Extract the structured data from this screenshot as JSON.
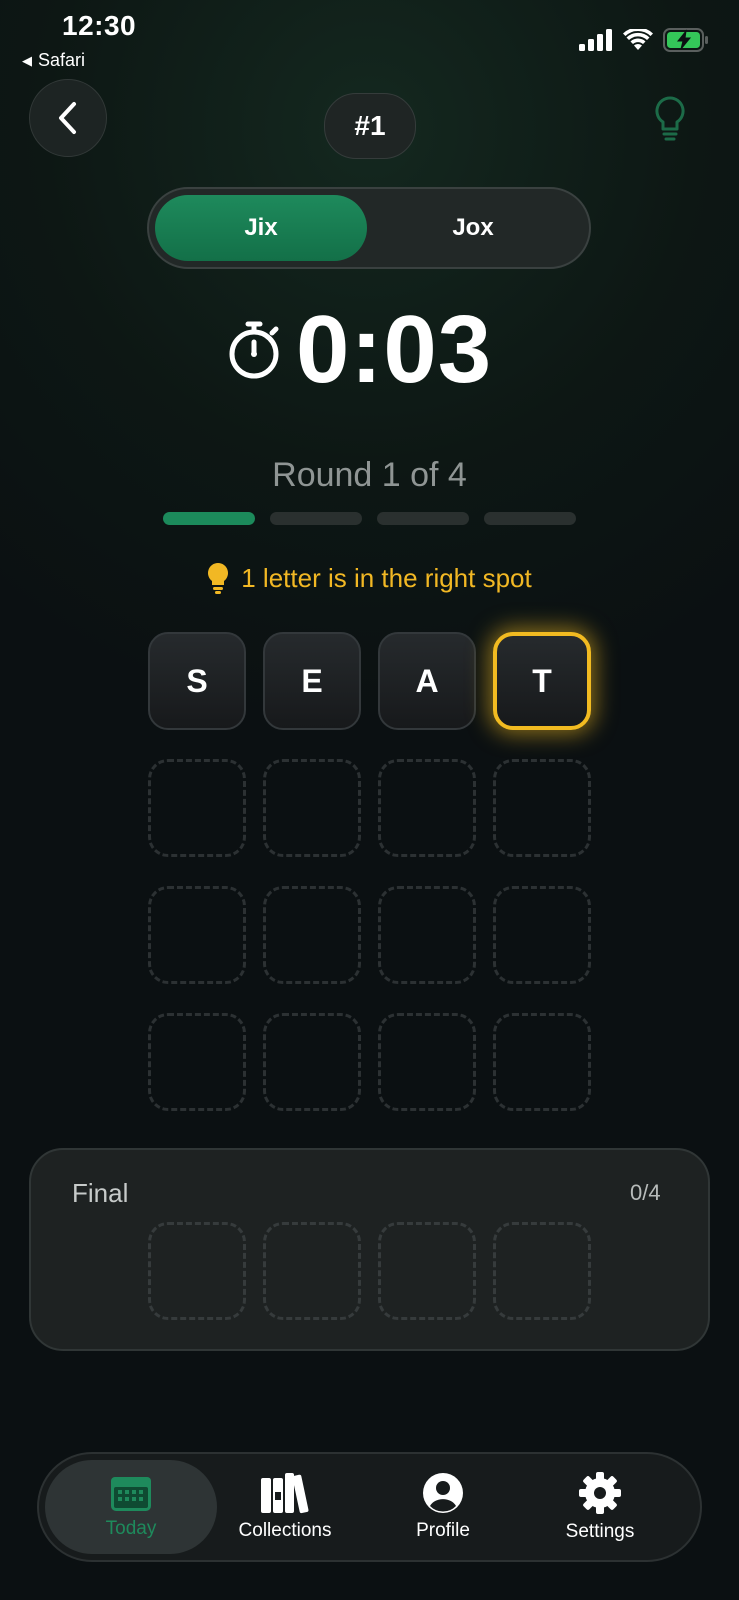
{
  "status_bar": {
    "time": "12:30",
    "back_app": "Safari"
  },
  "header": {
    "puzzle_number": "#1"
  },
  "segmented": {
    "options": [
      {
        "label": "Jix",
        "active": true
      },
      {
        "label": "Jox",
        "active": false
      }
    ]
  },
  "timer": {
    "value": "0:03"
  },
  "round": {
    "label": "Round 1 of 4",
    "current": 1,
    "total": 4
  },
  "hint": {
    "text": "1 letter is in the right spot"
  },
  "guesses": [
    [
      "S",
      "E",
      "A",
      "T"
    ],
    [
      "",
      "",
      "",
      ""
    ],
    [
      "",
      "",
      "",
      ""
    ],
    [
      "",
      "",
      "",
      ""
    ]
  ],
  "final": {
    "label": "Final",
    "count": "0/4"
  },
  "tabs": [
    {
      "label": "Today",
      "icon": "calendar-icon",
      "active": true
    },
    {
      "label": "Collections",
      "icon": "books-icon",
      "active": false
    },
    {
      "label": "Profile",
      "icon": "profile-icon",
      "active": false
    },
    {
      "label": "Settings",
      "icon": "gear-icon",
      "active": false
    }
  ],
  "colors": {
    "accent_green": "#1e8a5c",
    "highlight_yellow": "#f2bb21"
  }
}
